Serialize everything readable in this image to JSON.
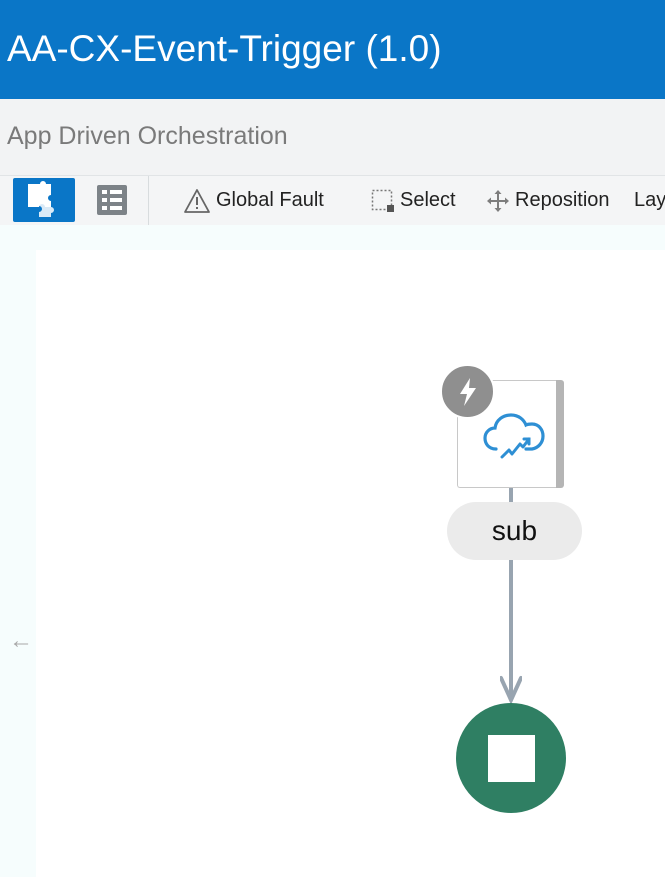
{
  "header": {
    "title": "AA-CX-Event-Trigger (1.0)"
  },
  "subheader": {
    "title": "App Driven Orchestration"
  },
  "toolbar": {
    "views": [
      {
        "icon": "puzzle-icon",
        "active": true
      },
      {
        "icon": "list-icon",
        "active": false
      }
    ],
    "global_fault_label": "Global Fault",
    "select_label": "Select",
    "reposition_label": "Reposition",
    "layout_label": "Lay"
  },
  "canvas": {
    "back_arrow": "←",
    "trigger_node": {
      "badge_icon": "lightning-bolt-icon",
      "icon": "cloud-trigger-icon",
      "label": "sub"
    },
    "end_node": {
      "icon": "stop-icon"
    }
  },
  "colors": {
    "header_bg": "#0a76c7",
    "stop_node": "#2f7f63",
    "connector": "#98a4b0",
    "badge": "#8f8f8f"
  }
}
